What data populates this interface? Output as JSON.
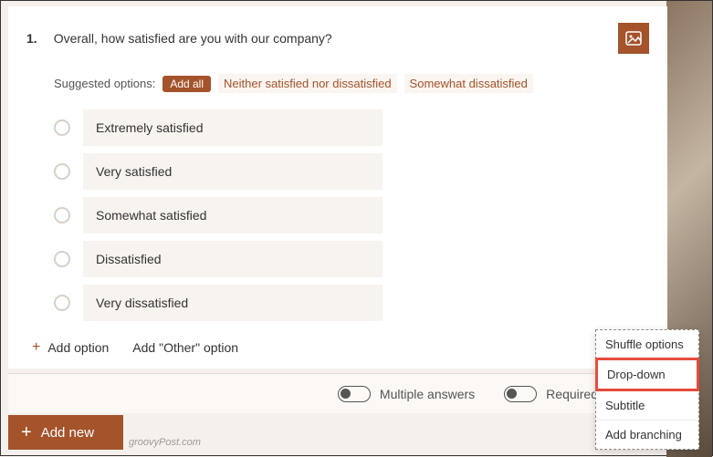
{
  "question": {
    "number": "1.",
    "text": "Overall, how satisfied are you with our company?"
  },
  "suggested": {
    "label": "Suggested options:",
    "add_all": "Add all",
    "chips": [
      "Neither satisfied nor dissatisfied",
      "Somewhat dissatisfied"
    ]
  },
  "options": [
    "Extremely satisfied",
    "Very satisfied",
    "Somewhat satisfied",
    "Dissatisfied",
    "Very dissatisfied"
  ],
  "add_option_label": "Add option",
  "add_other_label": "Add \"Other\" option",
  "toggles": {
    "multiple": "Multiple answers",
    "required": "Required"
  },
  "add_new_label": "Add new",
  "watermark": "groovyPost.com",
  "context_menu": {
    "items": [
      "Shuffle options",
      "Drop-down",
      "Subtitle",
      "Add branching"
    ],
    "highlighted_index": 1
  }
}
